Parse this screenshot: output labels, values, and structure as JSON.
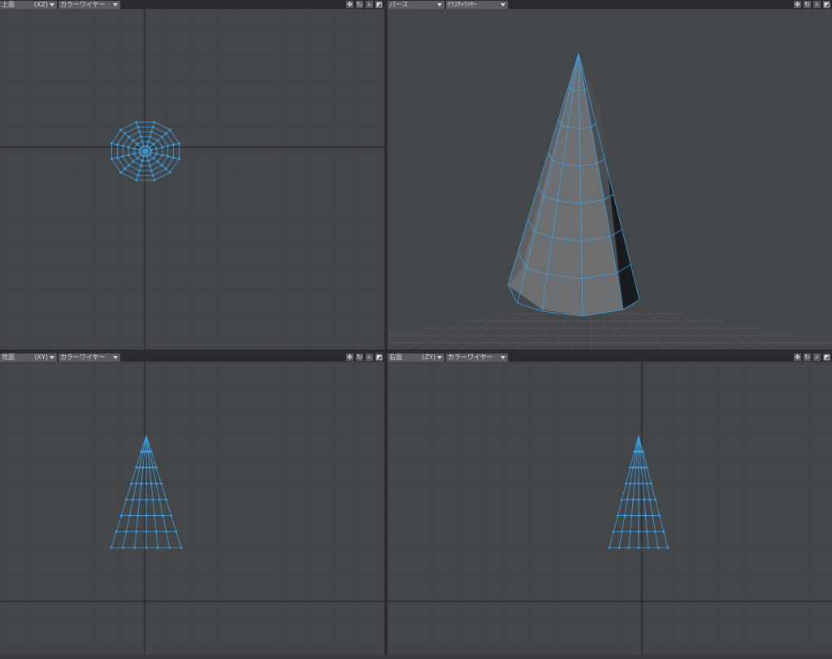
{
  "viewports": {
    "top_left": {
      "view": "上面",
      "axis": "(XZ)",
      "mode": "カラーワイヤー"
    },
    "top_right": {
      "view": "パース",
      "mode": "ﾃｸｽﾁｬﾜｲﾔｰ"
    },
    "bottom_left": {
      "view": "背面",
      "axis": "(XY)",
      "mode": "カラーワイヤー"
    },
    "bottom_right": {
      "view": "右面",
      "axis": "(ZY)",
      "mode": "カラーワイヤー"
    }
  },
  "icons": [
    "move-icon",
    "rotate-icon",
    "zoom-icon",
    "maximize-icon"
  ],
  "colors": {
    "viewport_bg": "#44474a",
    "grid": "#3c3e41",
    "wire": "#3aa0e6",
    "header": "#2a2b2d"
  }
}
